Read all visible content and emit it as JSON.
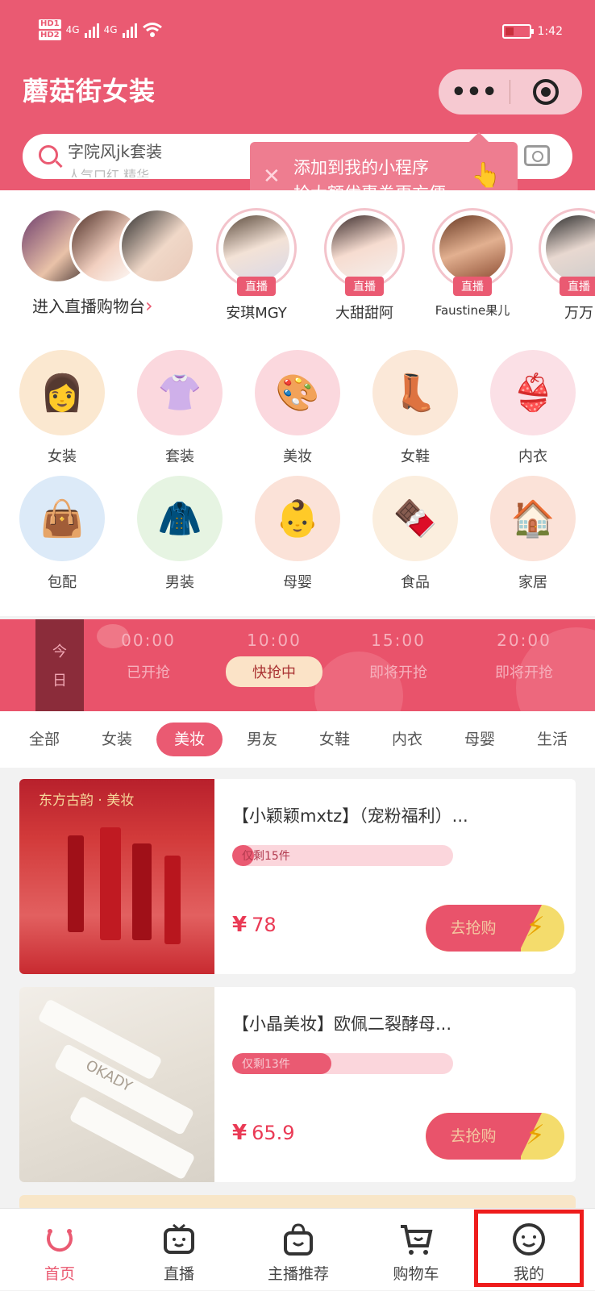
{
  "status_bar": {
    "hd1": "HD1",
    "hd2": "HD2",
    "net1": "4G",
    "net2": "4G",
    "time": "1:42"
  },
  "header": {
    "title": "蘑菇街女装",
    "more_label": "•••"
  },
  "search": {
    "placeholder": "字院风jk套装",
    "secondary": "人气口红 精华"
  },
  "tooltip": {
    "line1": "添加到我的小程序",
    "line2": "抢大额优惠券更方便",
    "close": "✕",
    "hand": "👆"
  },
  "live": {
    "entry_label": "进入直播购物台",
    "entry_arrow": "›",
    "anchors": [
      {
        "name": "安琪MGY",
        "badge": "直播"
      },
      {
        "name": "大甜甜阿",
        "badge": "直播"
      },
      {
        "name": "Faustine果儿",
        "badge": "直播"
      },
      {
        "name": "万万",
        "badge": "直播"
      }
    ]
  },
  "categories": [
    {
      "label": "女装",
      "icon": "👩"
    },
    {
      "label": "套装",
      "icon": "👚"
    },
    {
      "label": "美妆",
      "icon": "🎨"
    },
    {
      "label": "女鞋",
      "icon": "👢"
    },
    {
      "label": "内衣",
      "icon": "👙"
    },
    {
      "label": "包配",
      "icon": "👜"
    },
    {
      "label": "男装",
      "icon": "🧥"
    },
    {
      "label": "母婴",
      "icon": "👶"
    },
    {
      "label": "食品",
      "icon": "🍫"
    },
    {
      "label": "家居",
      "icon": "🏠"
    }
  ],
  "flash_sale": {
    "today_1": "今",
    "today_2": "日",
    "slots": [
      {
        "time": "00:00",
        "status": "已开抢"
      },
      {
        "time": "10:00",
        "status": "快抢中"
      },
      {
        "time": "15:00",
        "status": "即将开抢"
      },
      {
        "time": "20:00",
        "status": "即将开抢"
      }
    ]
  },
  "tabs": [
    "全部",
    "女装",
    "美妆",
    "男友",
    "女鞋",
    "内衣",
    "母婴",
    "生活"
  ],
  "active_tab": "美妆",
  "products": [
    {
      "title": "【小颖颖mxtz】（宠粉福利）...",
      "progress_text": "仅剩15件",
      "progress": 0.1,
      "currency": "¥",
      "price": "78",
      "buy_label": "去抢购",
      "img_banner": "东方古韵 · 美妆"
    },
    {
      "title": "【小晶美妆】欧佩二裂酵母...",
      "progress_text": "仅剩13件",
      "progress": 0.45,
      "currency": "¥",
      "price": "65.9",
      "buy_label": "去抢购",
      "img_banner": "OKADY"
    }
  ],
  "bottom_nav": [
    {
      "label": "首页",
      "icon": "home-icon"
    },
    {
      "label": "直播",
      "icon": "tv-icon"
    },
    {
      "label": "主播推荐",
      "icon": "bag-icon"
    },
    {
      "label": "购物车",
      "icon": "cart-icon"
    },
    {
      "label": "我的",
      "icon": "profile-icon"
    }
  ],
  "colors": {
    "brand": "#ea5a72",
    "highlight_box": "#ee1c1c"
  }
}
